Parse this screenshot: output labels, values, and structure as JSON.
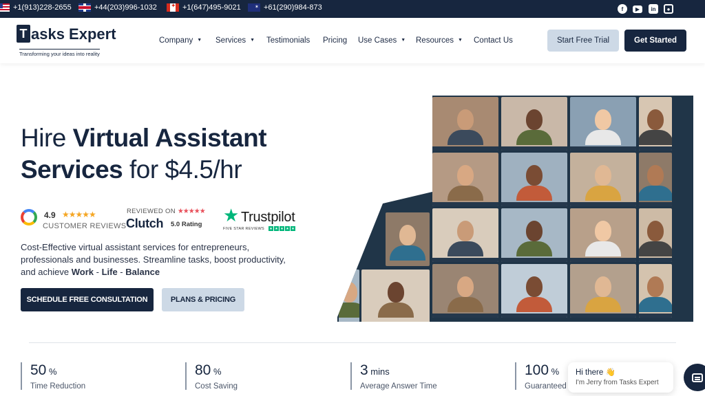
{
  "topbar": {
    "phones": [
      {
        "flag": "us-flag",
        "number": "+1(913)228-2655"
      },
      {
        "flag": "uk-flag",
        "number": "+44(203)996-1032"
      },
      {
        "flag": "canada-flag",
        "number": "+1(647)495-9021"
      },
      {
        "flag": "australia-flag",
        "number": "+61(290)984-873"
      }
    ],
    "social": [
      "facebook-icon",
      "youtube-icon",
      "linkedin-icon",
      "instagram-icon"
    ]
  },
  "brand": {
    "logo_letter": "T",
    "logo_text": "asks Expert",
    "tagline": "Transforming your ideas into reality"
  },
  "nav": {
    "items": [
      "Company",
      "Services",
      "Testimonials",
      "Pricing",
      "Use Cases",
      "Resources",
      "Contact Us"
    ],
    "trial_label": "Start Free Trial",
    "started_label": "Get Started"
  },
  "hero": {
    "title_line1_light": "Hire ",
    "title_line1_bold": "Virtual Assistant",
    "title_line2_bold": "Services",
    "title_line2_light": " for $4.5/hr",
    "google_rating": "4.9",
    "google_label": "CUSTOMER REVIEWS",
    "clutch_reviewed": "REVIEWED ON",
    "clutch_name": "Clutch",
    "clutch_rating": "5.0 Rating",
    "trustpilot_name": "Trustpilot",
    "trustpilot_sub": "FIVE STAR REVIEWS",
    "desc_1": "Cost-Effective virtual assistant services for entrepreneurs, professionals and businesses. Streamline tasks, boost productivity, and achieve ",
    "desc_work": "Work",
    "desc_sep1": " - ",
    "desc_life": "Life",
    "desc_sep2": " - ",
    "desc_balance": "Balance",
    "consult_label": "SCHEDULE FREE CONSULTATION",
    "plans_label": "PLANS & PRICING"
  },
  "stats": [
    {
      "value": "50",
      "unit": " %",
      "label": "Time Reduction"
    },
    {
      "value": "80",
      "unit": " %",
      "label": "Cost Saving"
    },
    {
      "value": "3",
      "unit": " mins",
      "label": "Average Answer Time"
    },
    {
      "value": "100",
      "unit": " %",
      "label": "Guaranteed"
    }
  ],
  "chat": {
    "greeting": "Hi there 👋",
    "intro": "I'm Jerry from Tasks Expert"
  },
  "colors": {
    "brand_navy": "#17263f",
    "light_button": "#cdd9e6",
    "google_star": "#f5a623",
    "clutch_star": "#e8505b",
    "trustpilot_green": "#00b67a"
  }
}
